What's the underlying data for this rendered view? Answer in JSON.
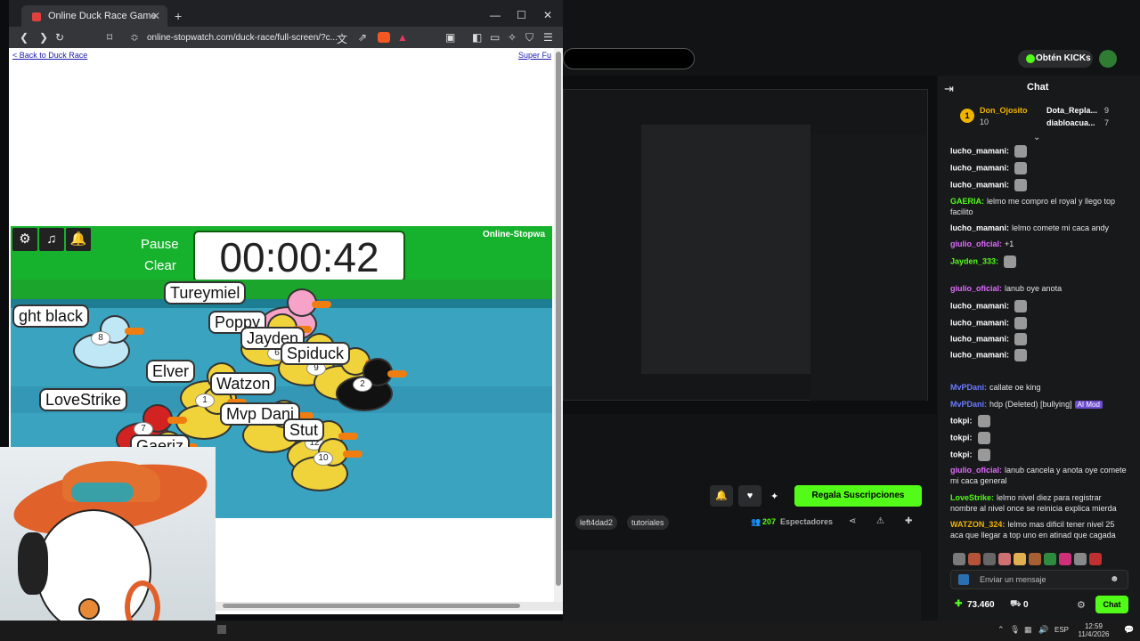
{
  "browser": {
    "tab_title": "Online Duck Race Game",
    "url": "online-stopwatch.com/duck-race/full-screen/?c..."
  },
  "page": {
    "back_link": "< Back to Duck Race",
    "super_link": "Super Fu",
    "pause_label": "Pause",
    "clear_label": "Clear",
    "timer": "00:00:42",
    "brand": "Online-Stopwa"
  },
  "ducks": [
    {
      "name": "ght black",
      "num": "8",
      "color": "#bfe7f5"
    },
    {
      "name": "Tureymiel",
      "num": "",
      "color": "#f6a3c9"
    },
    {
      "name": "Poppy",
      "num": "",
      "color": "#f0d23a"
    },
    {
      "name": "Jayden",
      "num": "6",
      "color": "#f0d23a"
    },
    {
      "name": "Spiduck",
      "num": "9",
      "color": "#f0d23a"
    },
    {
      "name": "Elver",
      "num": "",
      "color": "#f0d23a"
    },
    {
      "name": "Watzon",
      "num": "1",
      "color": "#f0d23a"
    },
    {
      "name": "LoveStrike",
      "num": "7",
      "color": "#d32222"
    },
    {
      "name": "Mvp Dani",
      "num": "",
      "color": "#f0d23a"
    },
    {
      "name": "Stut",
      "num": "12",
      "color": "#f0d23a"
    },
    {
      "name": "Gaeriz",
      "num": "",
      "color": "#f0d23a"
    },
    {
      "name": "",
      "num": "2",
      "color": "#111111"
    },
    {
      "name": "",
      "num": "10",
      "color": "#f0d23a"
    }
  ],
  "kick": {
    "obtain_label": "Obtén KICKs",
    "chat_header": "Chat",
    "top_users": [
      "Don_Ojosito",
      "Dota_Repla...",
      "diabloacua..."
    ],
    "top_counts": [
      "10",
      "9",
      "7"
    ],
    "messages": [
      {
        "user": "lucho_mamani:",
        "text": ""
      },
      {
        "user": "lucho_mamani:",
        "text": ""
      },
      {
        "user": "lucho_mamani:",
        "text": ""
      },
      {
        "user": "GAERIA:",
        "text": "lelmo me compro el royal y llego top facilito"
      },
      {
        "user": "lucho_mamani:",
        "text": "lelmo comete mi caca andy"
      },
      {
        "user": "giulio_oficial:",
        "text": "+1"
      },
      {
        "user": "Jayden_333:",
        "text": ""
      },
      {
        "user": "giulio_oficial:",
        "text": "lanub oye anota"
      },
      {
        "user": "lucho_mamani:",
        "text": ""
      },
      {
        "user": "lucho_mamani:",
        "text": ""
      },
      {
        "user": "lucho_mamani:",
        "text": ""
      },
      {
        "user": "lucho_mamani:",
        "text": ""
      },
      {
        "user": "MvPDani:",
        "text": "callate oe king"
      },
      {
        "user": "MvPDani:",
        "text": "hdp (Deleted) [bullying]"
      },
      {
        "user": "tokpi:",
        "text": ""
      },
      {
        "user": "tokpi:",
        "text": ""
      },
      {
        "user": "tokpi:",
        "text": ""
      },
      {
        "user": "giulio_oficial:",
        "text": "lanub cancela y anota oye comete mi caca general"
      },
      {
        "user": "LoveStrike:",
        "text": "lelmo nivel diez para registrar nombre al nivel once se reinicia explica mierda"
      },
      {
        "user": "WATZON_324:",
        "text": "lelmo mas dificil tener nivel 25 aca que llegar a top uno en atinad que cagada"
      }
    ],
    "badge_ai": "AI Mod",
    "message_placeholder": "Enviar un mensaje",
    "kicks_count": "73.460",
    "gift_count": "0",
    "chat_button": "Chat",
    "subs_button": "Regala Suscripciones",
    "tags": [
      "left4dad2",
      "tutoriales"
    ],
    "viewers_count": "207",
    "viewers_label": "Espectadores"
  },
  "taskbar": {
    "lang": "ESP",
    "time": "12:59",
    "date": "11/4/2026"
  },
  "colors": {
    "kick_green": "#53fc18",
    "grass": "#17b22d",
    "water": "#3aa3c0"
  }
}
